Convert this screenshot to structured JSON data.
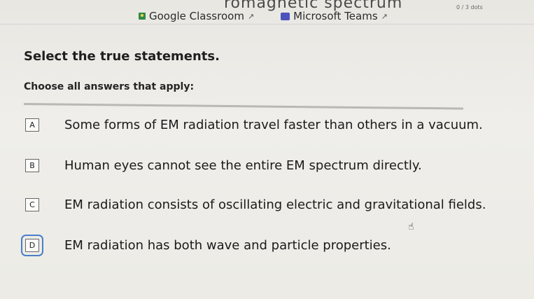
{
  "top_title_fragment": "romagnetic spectrum",
  "header": {
    "meta": "0 / 3 dots",
    "links": [
      {
        "label": "Google Classroom",
        "icon": "google-classroom-icon"
      },
      {
        "label": "Microsoft Teams",
        "icon": "microsoft-teams-icon"
      }
    ],
    "external_glyph": "↗"
  },
  "question": {
    "title": "Select the true statements.",
    "instruction": "Choose all answers that apply:"
  },
  "options": [
    {
      "letter": "A",
      "text": "Some forms of EM radiation travel faster than others in a vacuum."
    },
    {
      "letter": "B",
      "text": "Human eyes cannot see the entire EM spectrum directly."
    },
    {
      "letter": "C",
      "text": "EM radiation consists of oscillating electric and gravitational fields."
    },
    {
      "letter": "D",
      "text": "EM radiation has both wave and particle properties."
    }
  ],
  "cursor": {
    "icon": "hand-pointer-icon",
    "glyph": "☝"
  }
}
